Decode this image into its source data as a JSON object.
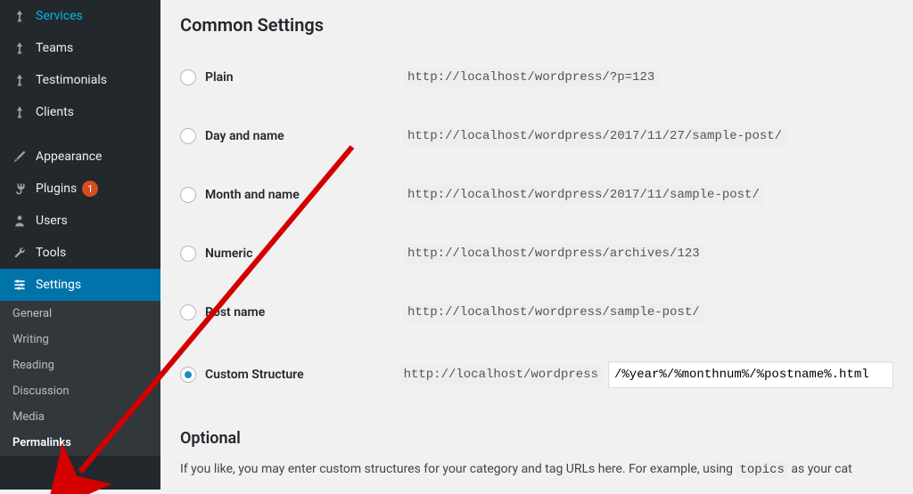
{
  "sidebar": {
    "items": [
      {
        "label": "Services",
        "icon": "pin"
      },
      {
        "label": "Teams",
        "icon": "pin"
      },
      {
        "label": "Testimonials",
        "icon": "pin"
      },
      {
        "label": "Clients",
        "icon": "pin"
      },
      {
        "label": "Appearance",
        "icon": "brush"
      },
      {
        "label": "Plugins",
        "icon": "plug",
        "badge": "1"
      },
      {
        "label": "Users",
        "icon": "users"
      },
      {
        "label": "Tools",
        "icon": "wrench"
      },
      {
        "label": "Settings",
        "icon": "sliders",
        "active": true
      }
    ],
    "sub": [
      {
        "label": "General"
      },
      {
        "label": "Writing"
      },
      {
        "label": "Reading"
      },
      {
        "label": "Discussion"
      },
      {
        "label": "Media"
      },
      {
        "label": "Permalinks",
        "current": true
      }
    ]
  },
  "main": {
    "heading": "Common Settings",
    "rows": [
      {
        "label": "Plain",
        "example": "http://localhost/wordpress/?p=123"
      },
      {
        "label": "Day and name",
        "example": "http://localhost/wordpress/2017/11/27/sample-post/"
      },
      {
        "label": "Month and name",
        "example": "http://localhost/wordpress/2017/11/sample-post/"
      },
      {
        "label": "Numeric",
        "example": "http://localhost/wordpress/archives/123"
      },
      {
        "label": "Post name",
        "example": "http://localhost/wordpress/sample-post/"
      }
    ],
    "custom": {
      "label": "Custom Structure",
      "prefix": "http://localhost/wordpress",
      "value": "/%year%/%monthnum%/%postname%.html"
    },
    "optional_heading": "Optional",
    "optional_text_1": "If you like, you may enter custom structures for your category and tag URLs here. For example, using ",
    "optional_code": "topics",
    "optional_text_2": " as your cat"
  }
}
